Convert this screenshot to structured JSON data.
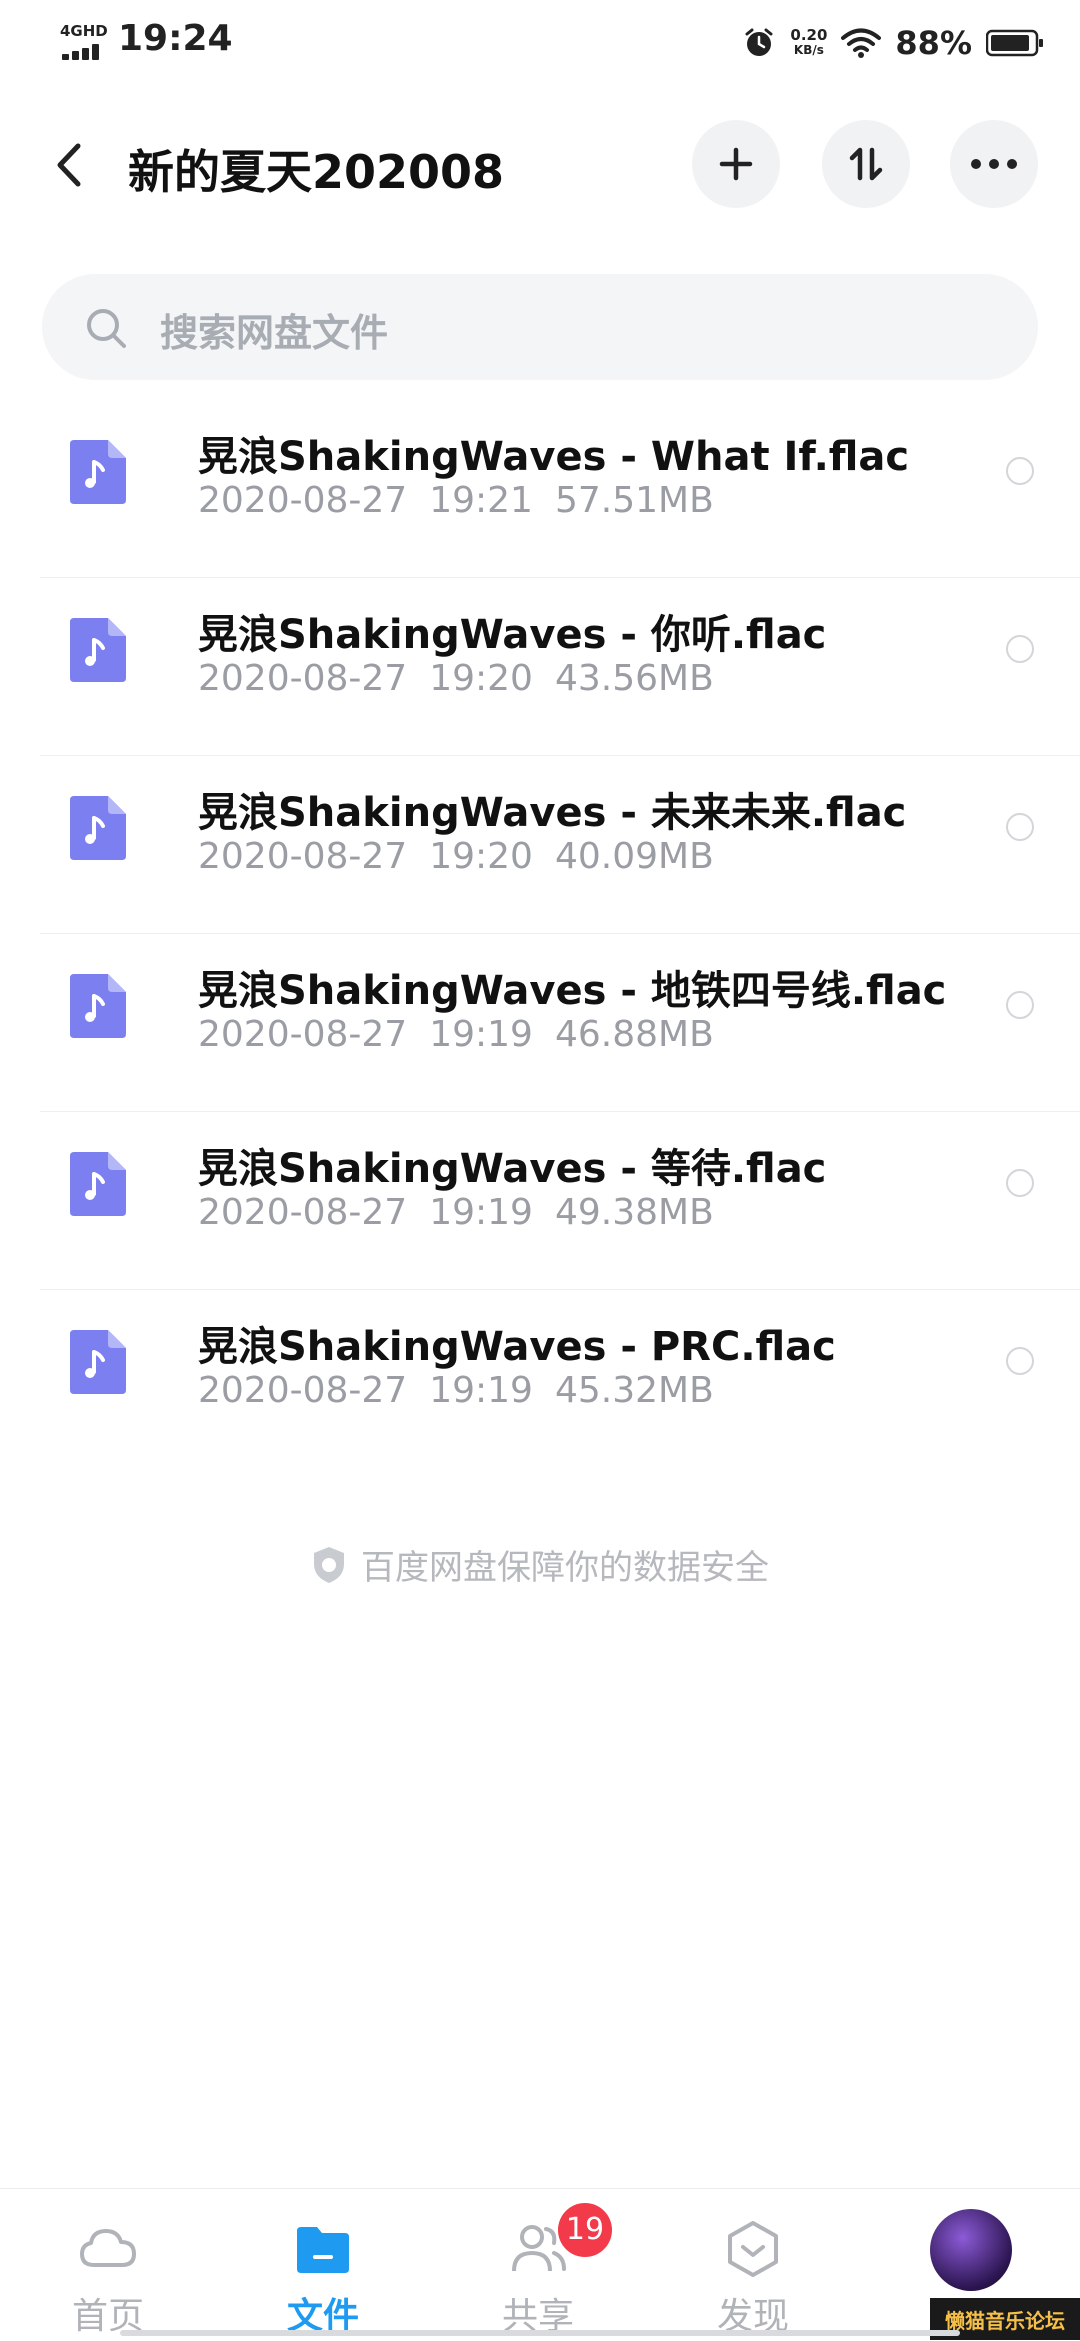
{
  "status": {
    "network": "4GHD",
    "time": "19:24",
    "speed_value": "0.20",
    "speed_unit": "KB/s",
    "battery": "88%"
  },
  "header": {
    "title": "新的夏天202008"
  },
  "search": {
    "placeholder": "搜索网盘文件"
  },
  "files": [
    {
      "name": "晃浪ShakingWaves - What If.flac",
      "date": "2020-08-27",
      "time": "19:21",
      "size": "57.51MB"
    },
    {
      "name": "晃浪ShakingWaves - 你听.flac",
      "date": "2020-08-27",
      "time": "19:20",
      "size": "43.56MB"
    },
    {
      "name": "晃浪ShakingWaves - 未来未来.flac",
      "date": "2020-08-27",
      "time": "19:20",
      "size": "40.09MB"
    },
    {
      "name": "晃浪ShakingWaves - 地铁四号线.flac",
      "date": "2020-08-27",
      "time": "19:19",
      "size": "46.88MB"
    },
    {
      "name": "晃浪ShakingWaves - 等待.flac",
      "date": "2020-08-27",
      "time": "19:19",
      "size": "49.38MB"
    },
    {
      "name": "晃浪ShakingWaves - PRC.flac",
      "date": "2020-08-27",
      "time": "19:19",
      "size": "45.32MB"
    }
  ],
  "footer_note": "百度网盘保障你的数据安全",
  "tabs": [
    {
      "label": "首页"
    },
    {
      "label": "文件"
    },
    {
      "label": "共享",
      "badge": "19"
    },
    {
      "label": "发现"
    }
  ],
  "brand_watermark": "懒猫音乐论坛",
  "colors": {
    "accent": "#1e9bf0",
    "file_icon": "#7b7ff0",
    "badge": "#f23a4a"
  }
}
